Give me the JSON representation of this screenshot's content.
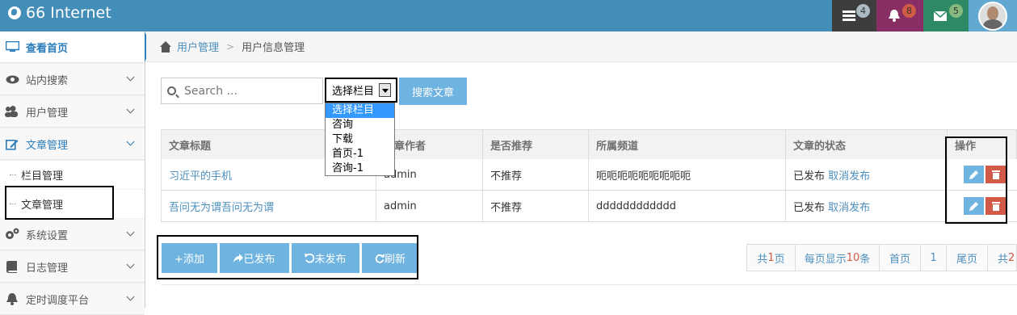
{
  "header": {
    "brand": "66 Internet",
    "badges": [
      {
        "icon": "tasks-icon",
        "count": "4",
        "color": "#3d3d3d",
        "badge_color": "#abbac3"
      },
      {
        "icon": "bell-icon",
        "count": "8",
        "color": "#892e65",
        "badge_color": "#d15b47"
      },
      {
        "icon": "envelope-icon",
        "count": "5",
        "color": "#2e8965",
        "badge_color": "#87b87f"
      }
    ]
  },
  "sidebar": {
    "items": [
      {
        "label": "查看首页",
        "icon": "desktop-icon"
      },
      {
        "label": "站内搜索",
        "icon": "eye-icon"
      },
      {
        "label": "用户管理",
        "icon": "users-icon"
      },
      {
        "label": "文章管理",
        "icon": "edit-icon"
      },
      {
        "label": "栏目管理"
      },
      {
        "label": "文章管理"
      },
      {
        "label": "系统设置",
        "icon": "cogs-icon"
      },
      {
        "label": "日志管理",
        "icon": "book-icon"
      },
      {
        "label": "定时调度平台",
        "icon": "bell-icon"
      }
    ]
  },
  "breadcrumb": {
    "parent": "用户管理",
    "current": "用户信息管理"
  },
  "search": {
    "placeholder": "Search ...",
    "select_value": "选择栏目",
    "options": [
      "选择栏目",
      "咨询",
      "下载",
      "首页-1",
      "咨询-1"
    ],
    "button": "搜索文章"
  },
  "table": {
    "headers": [
      "文章标题",
      "文章作者",
      "是否推荐",
      "所属频道",
      "文章的状态",
      "操作"
    ],
    "rows": [
      {
        "title": "习近平的手机",
        "author": "admin",
        "recommend": "不推荐",
        "channel": "呃呃呃呃呃呃呃呃呃",
        "status": "已发布",
        "action": "取消发布"
      },
      {
        "title": "吾问无为谓吾问无为谓",
        "author": "admin",
        "recommend": "不推荐",
        "channel": "dddddddddddd",
        "status": "已发布",
        "action": "取消发布"
      }
    ]
  },
  "buttons": {
    "add": "+添加",
    "published": "已发布",
    "unpublished": "未发布",
    "refresh": "刷新"
  },
  "pagination": {
    "total_pages_prefix": "共",
    "total_pages": "1",
    "total_pages_suffix": " 页",
    "per_page_prefix": "每页显示",
    "per_page": "10",
    "per_page_suffix": "条",
    "first": "首页",
    "page": "1",
    "last": "尾页",
    "total_prefix": "共",
    "total": "2"
  },
  "colors": {
    "header": "#438eb9",
    "accent": "#6fb3e0",
    "danger": "#d15b47",
    "link": "#4c8fbd"
  }
}
